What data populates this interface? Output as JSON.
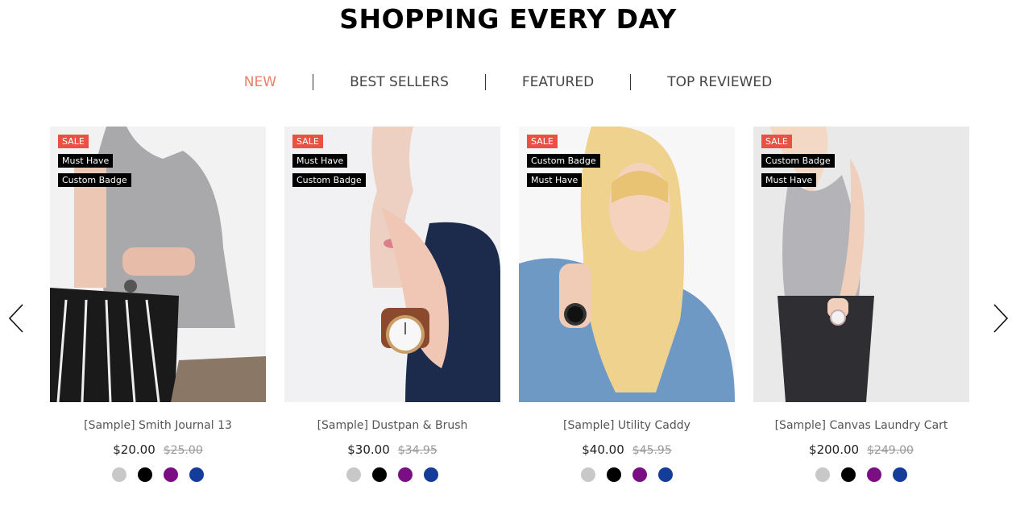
{
  "heading": "SHOPPING EVERY DAY",
  "tabs": [
    {
      "label": "NEW",
      "active": true
    },
    {
      "label": "BEST SELLERS",
      "active": false
    },
    {
      "label": "FEATURED",
      "active": false
    },
    {
      "label": "TOP REVIEWED",
      "active": false
    }
  ],
  "nav": {
    "prev_icon": "chevron-left-icon",
    "next_icon": "chevron-right-icon"
  },
  "accent_color": "#e8806a",
  "sale_color": "#e95144",
  "swatch_colors": [
    "#c8c8c8",
    "#000000",
    "#7a0f83",
    "#143d9a"
  ],
  "products": [
    {
      "name": "[Sample] Smith Journal 13",
      "price": "$20.00",
      "old_price": "$25.00",
      "badges": [
        "SALE",
        "Must Have",
        "Custom Badge"
      ]
    },
    {
      "name": "[Sample] Dustpan & Brush",
      "price": "$30.00",
      "old_price": "$34.95",
      "badges": [
        "SALE",
        "Must Have",
        "Custom Badge"
      ]
    },
    {
      "name": "[Sample] Utility Caddy",
      "price": "$40.00",
      "old_price": "$45.95",
      "badges": [
        "SALE",
        "Custom Badge",
        "Must Have"
      ]
    },
    {
      "name": "[Sample] Canvas Laundry Cart",
      "price": "$200.00",
      "old_price": "$249.00",
      "badges": [
        "SALE",
        "Custom Badge",
        "Must Have"
      ]
    }
  ]
}
